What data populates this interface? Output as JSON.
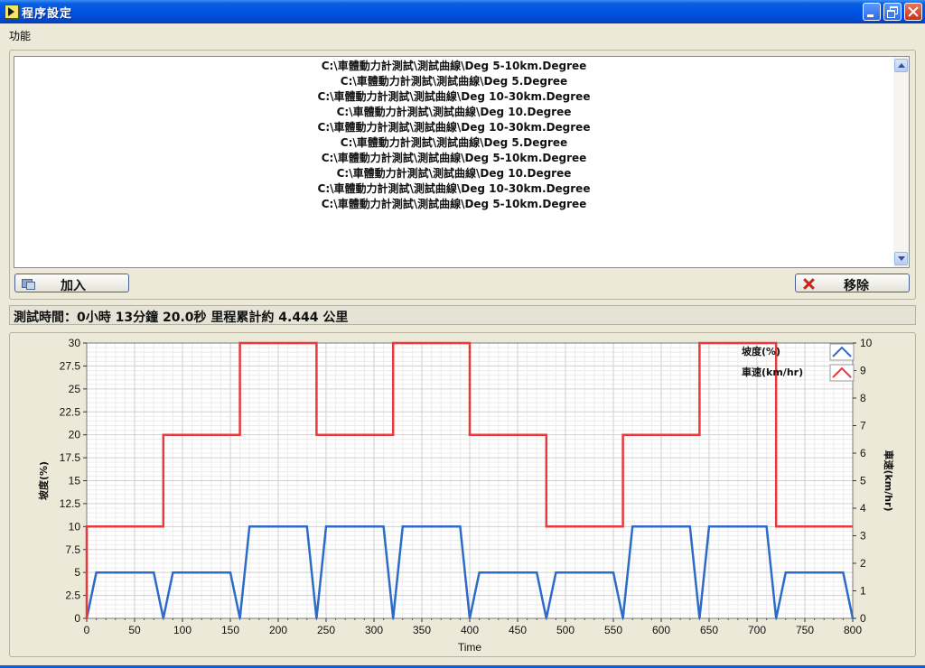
{
  "window": {
    "title": "程序設定"
  },
  "menu": {
    "items": [
      "功能"
    ]
  },
  "file_list": {
    "items": [
      "C:\\車體動力計測試\\測試曲線\\Deg 5-10km.Degree",
      "C:\\車體動力計測試\\測試曲線\\Deg 5.Degree",
      "C:\\車體動力計測試\\測試曲線\\Deg 10-30km.Degree",
      "C:\\車體動力計測試\\測試曲線\\Deg 10.Degree",
      "C:\\車體動力計測試\\測試曲線\\Deg 10-30km.Degree",
      "C:\\車體動力計測試\\測試曲線\\Deg 5.Degree",
      "C:\\車體動力計測試\\測試曲線\\Deg 5-10km.Degree",
      "C:\\車體動力計測試\\測試曲線\\Deg 10.Degree",
      "C:\\車體動力計測試\\測試曲線\\Deg 10-30km.Degree",
      "C:\\車體動力計測試\\測試曲線\\Deg 5-10km.Degree"
    ]
  },
  "buttons": {
    "add_label": "加入",
    "remove_label": "移除"
  },
  "status": {
    "text": "測試時間：0小時 13分鐘 20.0秒 里程累計約 4.444 公里"
  },
  "chart_data": {
    "type": "line",
    "xlabel": "Time",
    "ylabel": "坡度(%)",
    "y2label": "車速(km/hr)",
    "xlim": [
      0,
      800
    ],
    "ylim": [
      0,
      30
    ],
    "y2lim": [
      0,
      10
    ],
    "x_ticks": [
      0,
      50,
      100,
      150,
      200,
      250,
      300,
      350,
      400,
      450,
      500,
      550,
      600,
      650,
      700,
      750,
      800
    ],
    "y_ticks": [
      "0",
      "2.5",
      "5",
      "7.5",
      "10",
      "12.5",
      "15",
      "17.5",
      "20",
      "22.5",
      "25",
      "27.5",
      "30"
    ],
    "y2_ticks": [
      "0",
      "1",
      "2",
      "3",
      "4",
      "5",
      "6",
      "7",
      "8",
      "9",
      "10"
    ],
    "grid": true,
    "legend_position": "top-right",
    "series": [
      {
        "name": "坡度(%)",
        "color": "#2d6bc9",
        "axis": "left",
        "x": [
          0,
          10,
          70,
          80,
          90,
          150,
          160,
          170,
          230,
          240,
          250,
          310,
          320,
          330,
          390,
          400,
          410,
          470,
          480,
          490,
          550,
          560,
          570,
          630,
          640,
          650,
          710,
          720,
          730,
          790,
          800
        ],
        "y": [
          0,
          5,
          5,
          0,
          5,
          5,
          0,
          10,
          10,
          0,
          10,
          10,
          0,
          10,
          10,
          0,
          5,
          5,
          0,
          5,
          5,
          0,
          10,
          10,
          0,
          10,
          10,
          0,
          5,
          5,
          0
        ]
      },
      {
        "name": "車速(km/hr)",
        "color": "#e8393d",
        "axis": "right",
        "x": [
          0,
          0,
          80,
          80,
          160,
          160,
          240,
          240,
          320,
          320,
          400,
          400,
          480,
          480,
          560,
          560,
          640,
          640,
          720,
          720,
          800
        ],
        "y": [
          0,
          10,
          10,
          20,
          20,
          30,
          30,
          20,
          20,
          30,
          30,
          20,
          20,
          10,
          10,
          20,
          20,
          30,
          30,
          10,
          10
        ]
      }
    ]
  }
}
